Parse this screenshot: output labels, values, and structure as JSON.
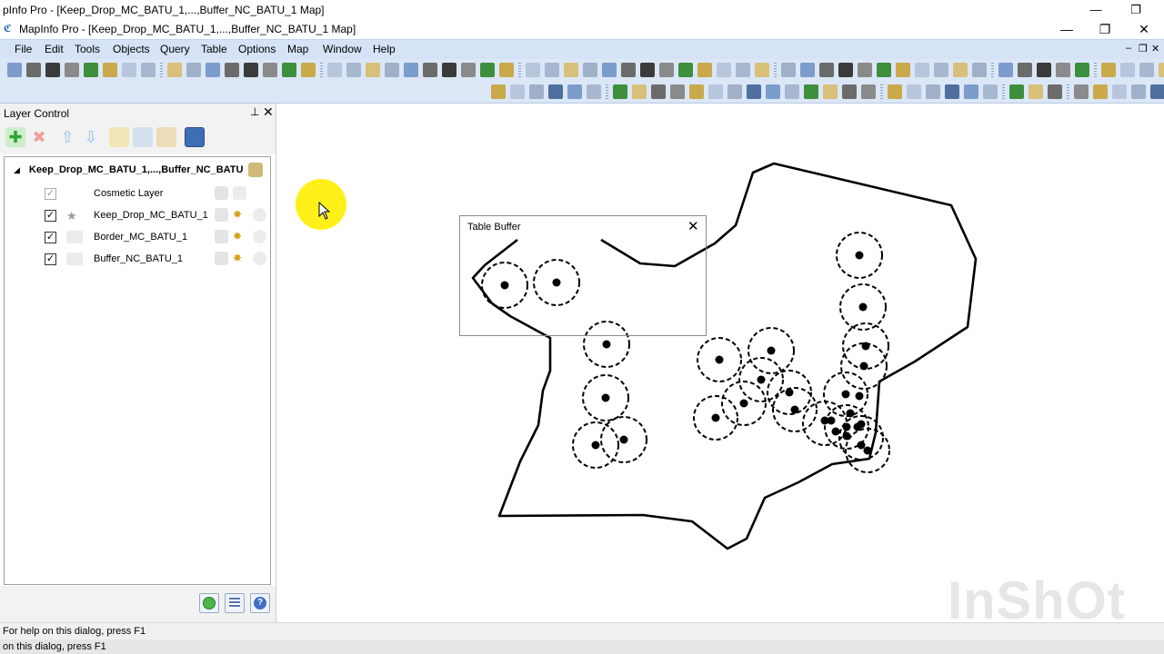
{
  "ghost_window": {
    "title": "pInfo Pro - [Keep_Drop_MC_BATU_1,...,Buffer_NC_BATU_1 Map]"
  },
  "window": {
    "title": "MapInfo Pro - [Keep_Drop_MC_BATU_1,...,Buffer_NC_BATU_1 Map]",
    "minimize": "—",
    "restore": "❐",
    "close": "✕"
  },
  "menu": [
    "File",
    "Edit",
    "Tools",
    "Objects",
    "Query",
    "Table",
    "Options",
    "Map",
    "Window",
    "Help"
  ],
  "mdi_controls": {
    "minimize": "–",
    "restore": "❐",
    "close": "✕"
  },
  "layer_control": {
    "title": "Layer Control",
    "pin": "📌",
    "close": "✕",
    "root_label": "Keep_Drop_MC_BATU_1,...,Buffer_NC_BATU",
    "layers": [
      {
        "name": "Cosmetic Layer",
        "checked": true,
        "dimmed": true
      },
      {
        "name": "Keep_Drop_MC_BATU_1",
        "checked": true,
        "dimmed": false
      },
      {
        "name": "Border_MC_BATU_1",
        "checked": true,
        "dimmed": false
      },
      {
        "name": "Buffer_NC_BATU_1",
        "checked": true,
        "dimmed": false
      }
    ]
  },
  "dialog": {
    "title": "Table Buffer",
    "close": "✕"
  },
  "status": {
    "line1": "For help on this dialog, press F1",
    "line2": "on this dialog, press F1"
  },
  "watermark": "InShOt",
  "colors": {
    "menubar": "#d6e3f7",
    "toolbar": "#dbe6f7",
    "cursor_highlight": "#ffee00"
  },
  "icons": [
    "add-layer-icon",
    "remove-layer-icon",
    "move-up-icon",
    "move-down-icon",
    "layer-properties-icon",
    "select-arrow-icon",
    "zoom-in-icon",
    "zoom-out-icon",
    "pan-hand-icon",
    "info-icon"
  ]
}
